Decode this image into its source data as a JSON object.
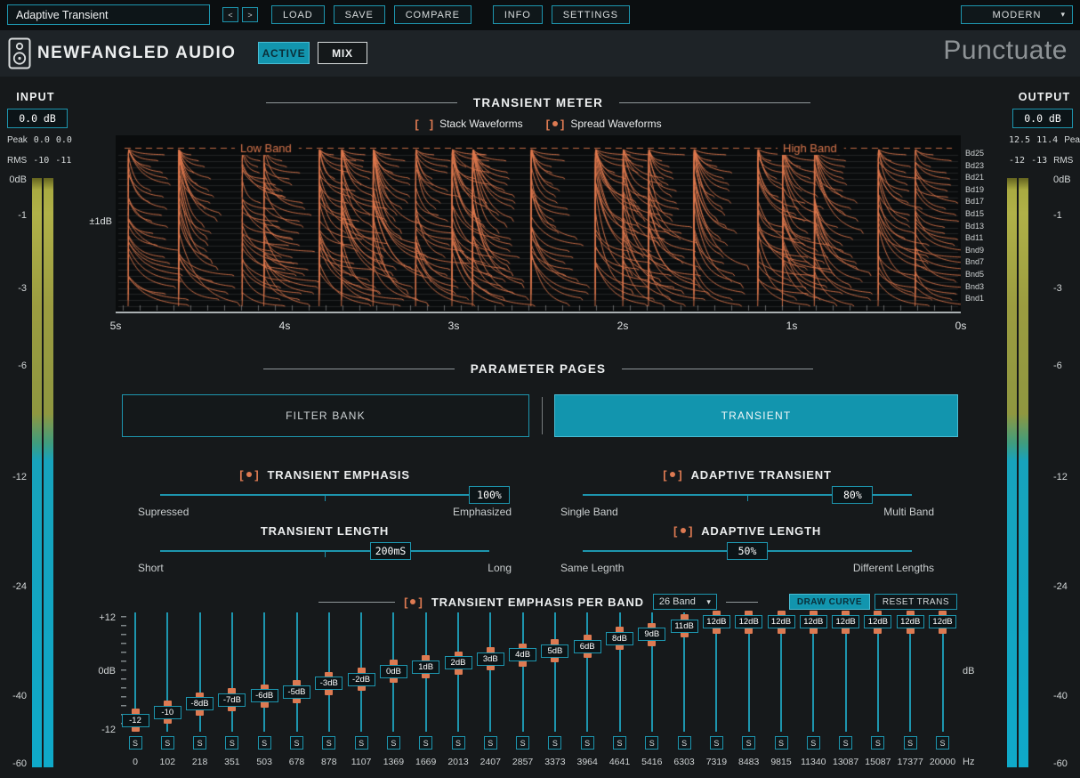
{
  "topbar": {
    "preset_name": "Adaptive Transient",
    "prev_label": "<",
    "next_label": ">",
    "buttons": [
      "LOAD",
      "SAVE",
      "COMPARE",
      "INFO",
      "SETTINGS"
    ],
    "skin": "MODERN"
  },
  "header": {
    "brand": "NEWFANGLED AUDIO",
    "active_label": "ACTIVE",
    "mix_label": "MIX",
    "product": "Punctuate"
  },
  "input_meter": {
    "title": "INPUT",
    "value": "0.0 dB",
    "peak_label": "Peak",
    "peak_values": [
      "0.0",
      "0.0"
    ],
    "rms_label": "RMS",
    "rms_values": [
      "-10",
      "-11"
    ],
    "scale": [
      "0dB",
      "-1",
      "-3",
      "-6",
      "-12",
      "-24",
      "-40",
      "-60"
    ]
  },
  "output_meter": {
    "title": "OUTPUT",
    "value": "0.0 dB",
    "peak_label": "Peak",
    "peak_values": [
      "12.5",
      "11.4"
    ],
    "rms_label": "RMS",
    "rms_values": [
      "-12",
      "-13"
    ],
    "scale": [
      "0dB",
      "-1",
      "-3",
      "-6",
      "-12",
      "-24",
      "-40",
      "-60"
    ]
  },
  "transient_meter": {
    "title": "TRANSIENT METER",
    "stack_option": {
      "label": "Stack Waveforms",
      "selected": false
    },
    "spread_option": {
      "label": "Spread Waveforms",
      "selected": true
    },
    "low_band_label": "Low Band",
    "high_band_label": "High Band",
    "amplitude_label": "±1dB",
    "band_labels": [
      "Bd25",
      "Bd23",
      "Bd21",
      "Bd19",
      "Bd17",
      "Bd15",
      "Bd13",
      "Bd11",
      "Bnd9",
      "Bnd7",
      "Bnd5",
      "Bnd3",
      "Bnd1"
    ],
    "time_labels": [
      "5s",
      "4s",
      "3s",
      "2s",
      "1s",
      "0s"
    ]
  },
  "parameter_pages": {
    "title": "PARAMETER PAGES",
    "tabs": [
      {
        "label": "FILTER BANK",
        "active": false
      },
      {
        "label": "TRANSIENT",
        "active": true
      }
    ]
  },
  "sliders": {
    "transient_emphasis": {
      "label": "TRANSIENT EMPHASIS",
      "enabled": true,
      "value": "100%",
      "pos": 1.0,
      "left_label": "Supressed",
      "right_label": "Emphasized"
    },
    "adaptive_transient": {
      "label": "ADAPTIVE TRANSIENT",
      "enabled": true,
      "value": "80%",
      "pos": 0.82,
      "left_label": "Single Band",
      "right_label": "Multi Band"
    },
    "transient_length": {
      "label": "TRANSIENT LENGTH",
      "value": "200mS",
      "pos": 0.7,
      "left_label": "Short",
      "right_label": "Long"
    },
    "adaptive_length": {
      "label": "ADAPTIVE LENGTH",
      "enabled": true,
      "value": "50%",
      "pos": 0.5,
      "left_label": "Same Legnth",
      "right_label": "Different Lengths"
    }
  },
  "per_band": {
    "title": "TRANSIENT EMPHASIS PER BAND",
    "enabled": true,
    "band_count": "26 Band",
    "draw_curve_label": "DRAW CURVE",
    "reset_label": "RESET TRANS",
    "scale_top": "+12",
    "scale_mid": "0dB",
    "scale_bottom": "-12",
    "db_unit": "dB",
    "hz_unit": "Hz",
    "solo_label": "S",
    "bands": [
      {
        "freq": "0",
        "value": -12,
        "value_label": "-12"
      },
      {
        "freq": "102",
        "value": -10,
        "value_label": "-10"
      },
      {
        "freq": "218",
        "value": -8,
        "value_label": "-8dB"
      },
      {
        "freq": "351",
        "value": -7,
        "value_label": "-7dB"
      },
      {
        "freq": "503",
        "value": -6,
        "value_label": "-6dB"
      },
      {
        "freq": "678",
        "value": -5,
        "value_label": "-5dB"
      },
      {
        "freq": "878",
        "value": -3,
        "value_label": "-3dB"
      },
      {
        "freq": "1107",
        "value": -2,
        "value_label": "-2dB"
      },
      {
        "freq": "1369",
        "value": 0,
        "value_label": "0dB"
      },
      {
        "freq": "1669",
        "value": 1,
        "value_label": "1dB"
      },
      {
        "freq": "2013",
        "value": 2,
        "value_label": "2dB"
      },
      {
        "freq": "2407",
        "value": 3,
        "value_label": "3dB"
      },
      {
        "freq": "2857",
        "value": 4,
        "value_label": "4dB"
      },
      {
        "freq": "3373",
        "value": 5,
        "value_label": "5dB"
      },
      {
        "freq": "3964",
        "value": 6,
        "value_label": "6dB"
      },
      {
        "freq": "4641",
        "value": 8,
        "value_label": "8dB"
      },
      {
        "freq": "5416",
        "value": 9,
        "value_label": "9dB"
      },
      {
        "freq": "6303",
        "value": 11,
        "value_label": "11dB"
      },
      {
        "freq": "7319",
        "value": 12,
        "value_label": "12dB"
      },
      {
        "freq": "8483",
        "value": 12,
        "value_label": "12dB"
      },
      {
        "freq": "9815",
        "value": 12,
        "value_label": "12dB"
      },
      {
        "freq": "11340",
        "value": 12,
        "value_label": "12dB"
      },
      {
        "freq": "13087",
        "value": 12,
        "value_label": "12dB"
      },
      {
        "freq": "15087",
        "value": 12,
        "value_label": "12dB"
      },
      {
        "freq": "17377",
        "value": 12,
        "value_label": "12dB"
      },
      {
        "freq": "20000",
        "value": 12,
        "value_label": "12dB"
      }
    ]
  },
  "colors": {
    "teal": "#1d95ae",
    "teal_fill": "#1295ae",
    "orange": "#dd7a52",
    "meter_cyan": "#14a6c2",
    "meter_olive": "#a3a344"
  }
}
